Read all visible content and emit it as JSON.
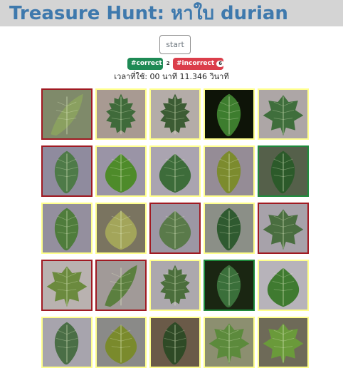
{
  "title": "Treasure Hunt: หาใบ durian",
  "start_label": "start",
  "badges": {
    "correct_label": "#correct",
    "correct_count": "2",
    "incorrect_label": "#incorrect",
    "incorrect_count": "6"
  },
  "timer": "เวลาที่ใช้: 00 นาที 11.346 วินาที",
  "colors": {
    "title": "#3e79ad",
    "correct": "#1e8a55",
    "incorrect": "#db3e4b",
    "tile_default_border": "#ffff8c",
    "tile_wrong_border": "#a01a22",
    "tile_right_border": "#1e8a3c"
  },
  "tiles": [
    {
      "status": "wrong",
      "bg": "#7f8a6a",
      "leaf": "#8aa060",
      "shape": "blade"
    },
    {
      "status": "default",
      "bg": "#a89a92",
      "leaf": "#3f6a3a",
      "shape": "serrated"
    },
    {
      "status": "default",
      "bg": "#b4aca8",
      "leaf": "#3c5c34",
      "shape": "serrated"
    },
    {
      "status": "default",
      "bg": "#0e1408",
      "leaf": "#3d7d2e",
      "shape": "oval"
    },
    {
      "status": "default",
      "bg": "#ada6a6",
      "leaf": "#3f6e3c",
      "shape": "lobed"
    },
    {
      "status": "wrong",
      "bg": "#8f8b9e",
      "leaf": "#4e7a48",
      "shape": "oval"
    },
    {
      "status": "default",
      "bg": "#9a94a6",
      "leaf": "#4e8b2a",
      "shape": "heart"
    },
    {
      "status": "default",
      "bg": "#aaa4b0",
      "leaf": "#3d6c3a",
      "shape": "heart"
    },
    {
      "status": "default",
      "bg": "#958c96",
      "leaf": "#7c8b2e",
      "shape": "oval"
    },
    {
      "status": "right",
      "bg": "#55604a",
      "leaf": "#2c5a2a",
      "shape": "oval"
    },
    {
      "status": "default",
      "bg": "#948f9e",
      "leaf": "#4f7c3c",
      "shape": "oval"
    },
    {
      "status": "default",
      "bg": "#7a7460",
      "leaf": "#a3a55a",
      "shape": "heart"
    },
    {
      "status": "wrong",
      "bg": "#9c97a4",
      "leaf": "#5a7a4a",
      "shape": "heart"
    },
    {
      "status": "default",
      "bg": "#8b8f87",
      "leaf": "#2f5a30",
      "shape": "oval"
    },
    {
      "status": "wrong",
      "bg": "#a7a2aa",
      "leaf": "#4a6e40",
      "shape": "lobed"
    },
    {
      "status": "wrong",
      "bg": "#b9b2b0",
      "leaf": "#6b8a3e",
      "shape": "lobed"
    },
    {
      "status": "wrong",
      "bg": "#a19a98",
      "leaf": "#5b7f3f",
      "shape": "blade"
    },
    {
      "status": "default",
      "bg": "#aca8ad",
      "leaf": "#4b6e3c",
      "shape": "serrated"
    },
    {
      "status": "right",
      "bg": "#1a2612",
      "leaf": "#3a6f3a",
      "shape": "oval"
    },
    {
      "status": "default",
      "bg": "#b7b3ba",
      "leaf": "#3f7a30",
      "shape": "heart"
    },
    {
      "status": "default",
      "bg": "#a7a4ad",
      "leaf": "#4a6e46",
      "shape": "oval"
    },
    {
      "status": "default",
      "bg": "#8a8a88",
      "leaf": "#7a8a2c",
      "shape": "heart"
    },
    {
      "status": "default",
      "bg": "#6a5a48",
      "leaf": "#2f4a26",
      "shape": "oval"
    },
    {
      "status": "default",
      "bg": "#8c8f70",
      "leaf": "#5c8a3c",
      "shape": "lobed"
    },
    {
      "status": "default",
      "bg": "#6e6a58",
      "leaf": "#6a9a3a",
      "shape": "lobed"
    }
  ]
}
